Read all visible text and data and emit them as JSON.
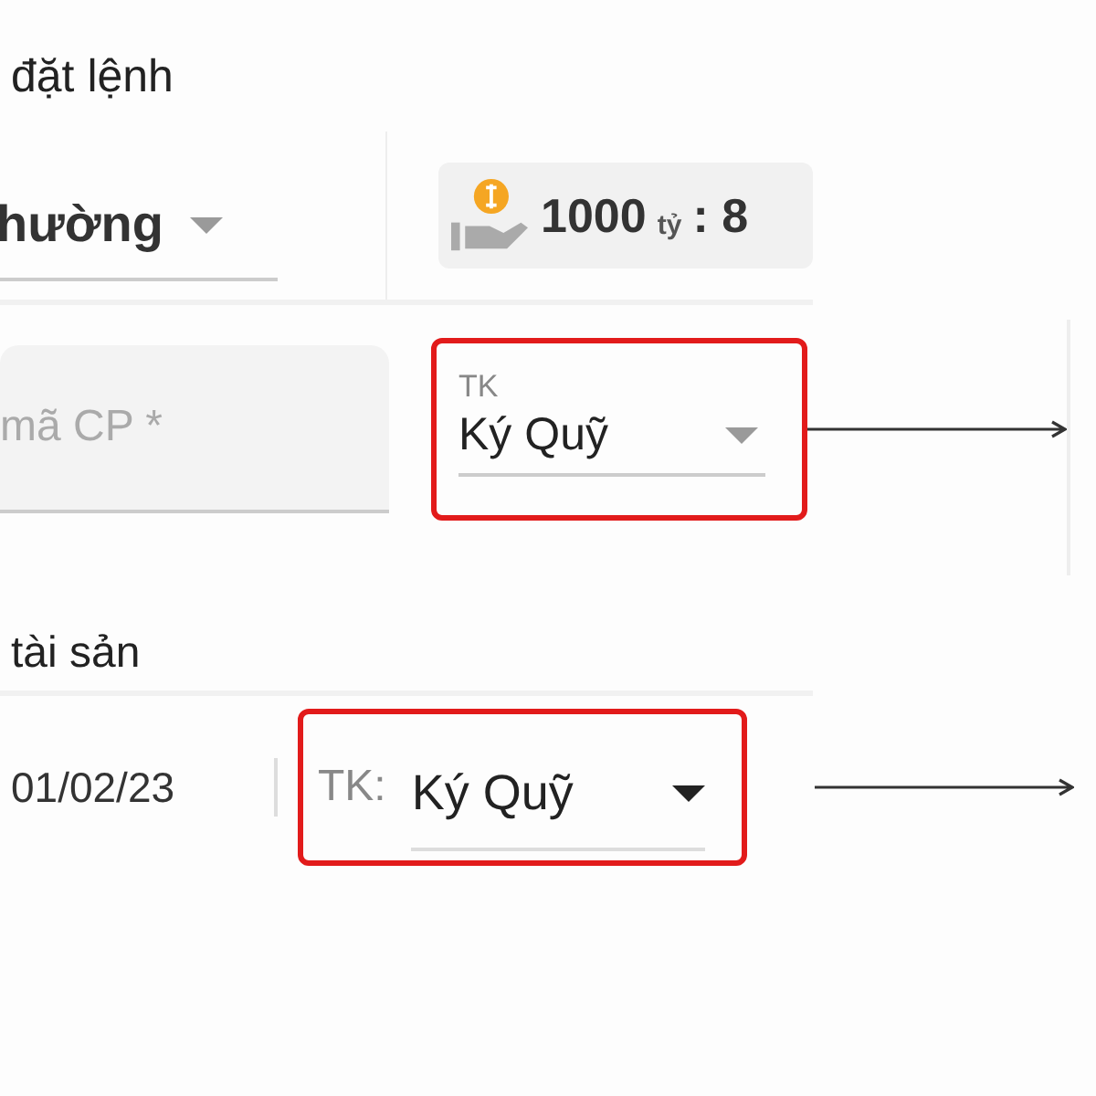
{
  "order_section": {
    "title": "đặt lệnh",
    "order_type": {
      "value": "hường"
    },
    "balance": {
      "amount": "1000",
      "unit": "tỷ",
      "rest": ": 8"
    },
    "symbol_field": {
      "placeholder": "mã CP *"
    },
    "account_select": {
      "label": "TK",
      "value": "Ký Quỹ",
      "highlighted": true
    }
  },
  "asset_section": {
    "title": "tài sản",
    "date": "01/02/23",
    "account_select": {
      "label": "TK:",
      "value": "Ký Quỹ",
      "highlighted": true
    }
  }
}
